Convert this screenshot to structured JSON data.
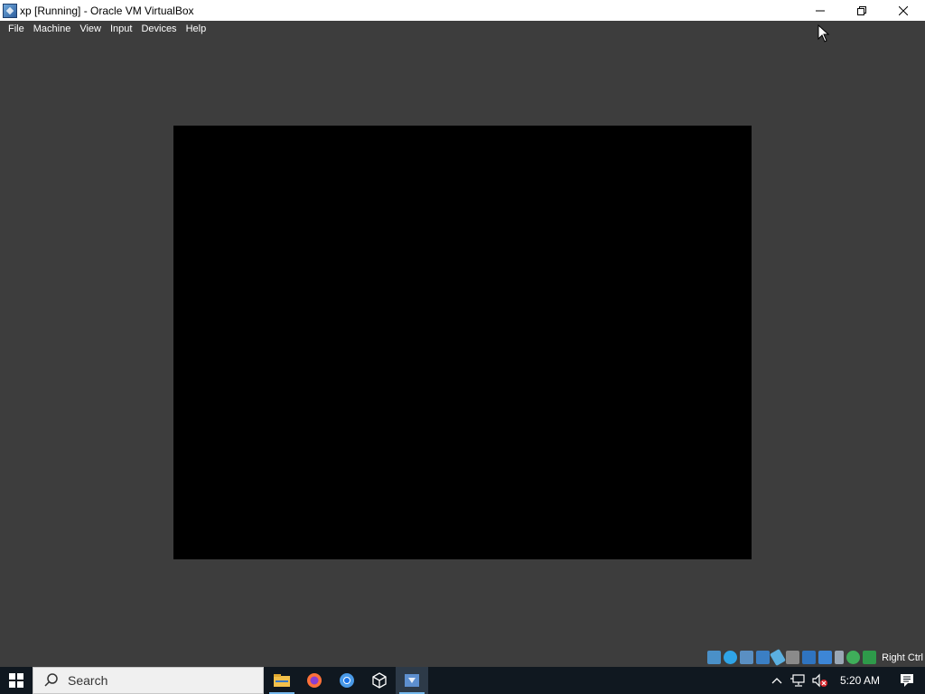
{
  "window": {
    "title": "xp [Running] - Oracle VM VirtualBox",
    "controls": {
      "minimize": "—",
      "maximize": "❐",
      "close": "✕"
    }
  },
  "menu": {
    "items": [
      "File",
      "Machine",
      "View",
      "Input",
      "Devices",
      "Help"
    ]
  },
  "statusbar": {
    "host_key": "Right Ctrl",
    "icons": [
      "hard-disk-icon",
      "optical-drive-icon",
      "audio-icon",
      "network-icon",
      "usb-icon",
      "shared-folders-icon",
      "display-icon",
      "recording-icon",
      "cpu-icon",
      "mouse-integration-icon",
      "keyboard-icon"
    ]
  },
  "taskbar": {
    "search_placeholder": "Search",
    "apps": [
      "file-explorer-icon",
      "firefox-icon",
      "chrome-icon",
      "virtualbox-manager-icon",
      "virtualbox-vm-icon"
    ],
    "clock": "5:20 AM"
  },
  "colors": {
    "window_bg": "#3d3d3d",
    "titlebar_bg": "#ffffff",
    "vm_screen": "#000000",
    "taskbar_bg": "#101820",
    "accent": "#76b9ed"
  }
}
